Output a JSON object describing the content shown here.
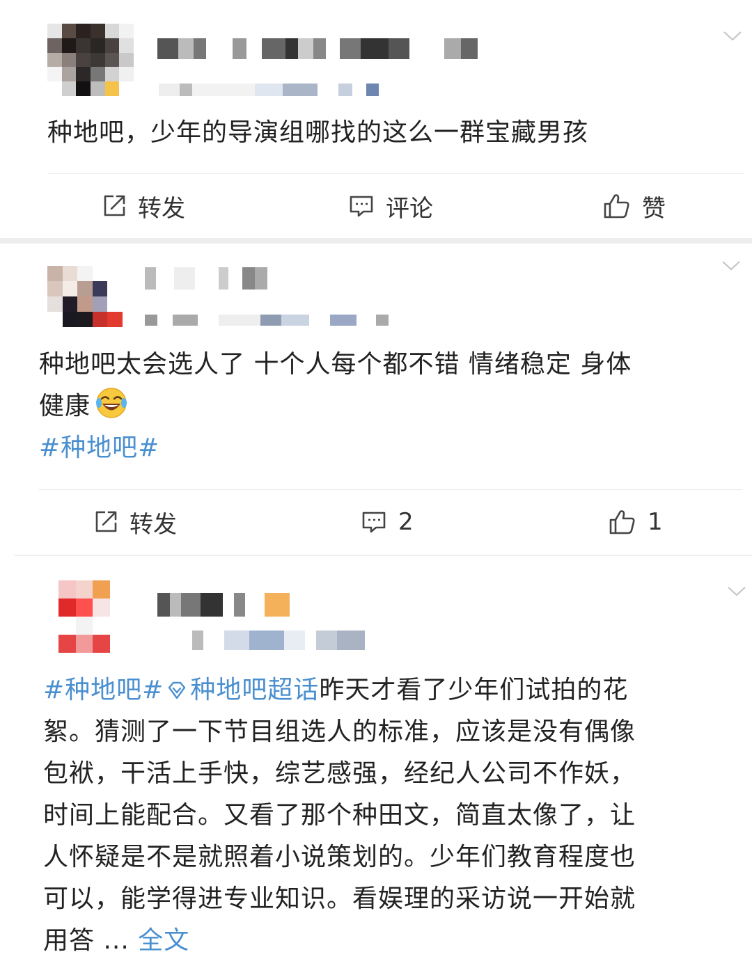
{
  "posts": [
    {
      "text": "种地吧，少年的导演组哪找的这么一群宝藏男孩",
      "actions": {
        "repost": "转发",
        "comment": "评论",
        "like": "赞"
      }
    },
    {
      "text_line1": "种地吧太会选人了 十个人每个都不错 情绪稳定 身体",
      "text_line2": "健康",
      "hashtag": "#种地吧#",
      "actions": {
        "repost": "转发",
        "comment": "2",
        "like": "1"
      }
    },
    {
      "hashtag": "#种地吧#",
      "supertopic": "种地吧超话",
      "line1": "昨天才看了少年们试拍的花",
      "line2": "絮。猜测了一下节目组选人的标准，应该是没有偶像",
      "line3": "包袱，干活上手快，综艺感强，经纪人公司不作妖，",
      "line4": "时间上能配合。又看了那个种田文，简直太像了，让",
      "line5": "人怀疑是不是就照着小说策划的。少年们教育程度也",
      "line6": "可以，能学得进专业知识。看娱理的采访说一开始就",
      "line7": "用答 ...",
      "more": "全文"
    }
  ],
  "icons": {
    "chevron": "chevron-down-icon",
    "repost": "repost-icon",
    "comment": "comment-icon",
    "like": "like-icon",
    "emoji": "laughing-tears-emoji",
    "supertopic": "diamond-icon"
  },
  "colors": {
    "link": "#4a8fcf",
    "text": "#222222",
    "action": "#333333"
  }
}
